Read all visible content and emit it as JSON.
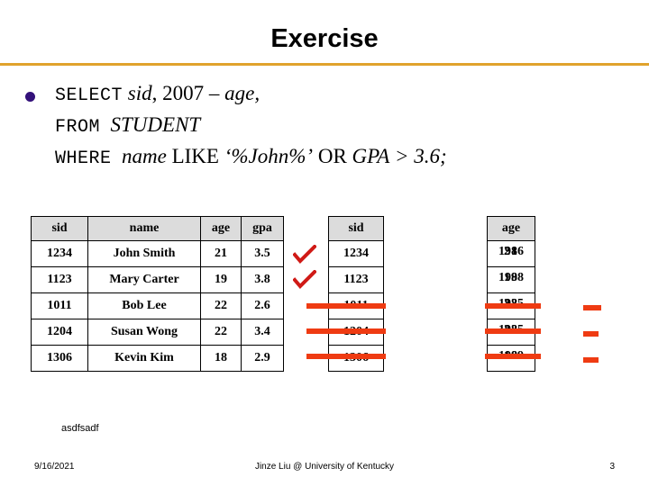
{
  "slide": {
    "title": "Exercise",
    "rule_color": "#e0a22c",
    "bullet_color": "#33117a",
    "annotation_color": "#ef3b12"
  },
  "query": {
    "line1": {
      "keyword": "SELECT",
      "rest_italic": "sid",
      "rest_roman": ", 2007 – ",
      "rest_italic2": "age,"
    },
    "line2": {
      "keyword": "FROM",
      "table": "STUDENT"
    },
    "line3": {
      "keyword": "WHERE",
      "column": "name",
      "op": "LIKE",
      "pattern": "‘%John%’",
      "conj": "OR",
      "column2": "GPA",
      "cmp": "> 3.6;"
    }
  },
  "student_table": {
    "headers": [
      "sid",
      "name",
      "age",
      "gpa"
    ],
    "rows": [
      [
        "1234",
        "John Smith",
        "21",
        "3.5"
      ],
      [
        "1123",
        "Mary Carter",
        "19",
        "3.8"
      ],
      [
        "1011",
        "Bob Lee",
        "22",
        "2.6"
      ],
      [
        "1204",
        "Susan Wong",
        "22",
        "3.4"
      ],
      [
        "1306",
        "Kevin Kim",
        "18",
        "2.9"
      ]
    ]
  },
  "sid_table": {
    "header": "sid",
    "rows": [
      "1234",
      "1123",
      "1011",
      "1204",
      "1306"
    ]
  },
  "age_table": {
    "header": "age",
    "rows": [
      {
        "birth_year": "1986",
        "age": "21"
      },
      {
        "birth_year": "1988",
        "age": "19"
      },
      {
        "birth_year": "1985",
        "age": "22"
      },
      {
        "birth_year": "1985",
        "age": "22"
      },
      {
        "birth_year": "1989",
        "age": "18"
      }
    ]
  },
  "annotations": {
    "checks": 2,
    "dashes": 3,
    "strikes": 3
  },
  "notes": {
    "scratch": "asdfsadf"
  },
  "footer": {
    "date": "9/16/2021",
    "center": "Jinze Liu @ University of Kentucky",
    "page": "3"
  }
}
